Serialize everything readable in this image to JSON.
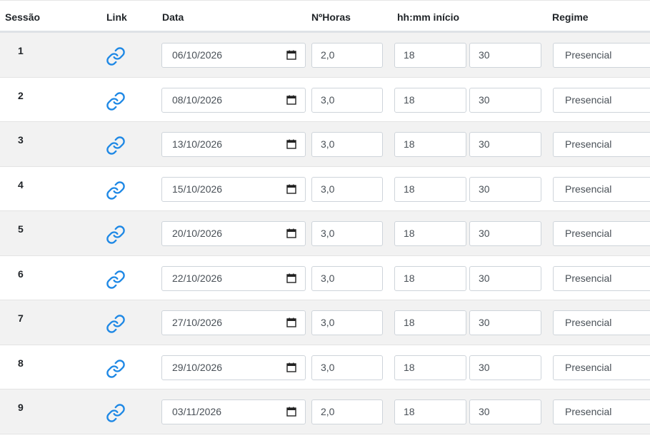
{
  "headers": {
    "sessao": "Sessão",
    "link": "Link",
    "data": "Data",
    "horas": "NºHoras",
    "inicio": "hh:mm início",
    "regime": "Regime"
  },
  "icons": {
    "link": "link-chain-icon",
    "calendar": "calendar-icon",
    "accent": "#1e88e5"
  },
  "rows": [
    {
      "num": "1",
      "date": "06/10/2026",
      "hours": "2,0",
      "hh": "18",
      "mm": "30",
      "regime": "Presencial"
    },
    {
      "num": "2",
      "date": "08/10/2026",
      "hours": "3,0",
      "hh": "18",
      "mm": "30",
      "regime": "Presencial"
    },
    {
      "num": "3",
      "date": "13/10/2026",
      "hours": "3,0",
      "hh": "18",
      "mm": "30",
      "regime": "Presencial"
    },
    {
      "num": "4",
      "date": "15/10/2026",
      "hours": "3,0",
      "hh": "18",
      "mm": "30",
      "regime": "Presencial"
    },
    {
      "num": "5",
      "date": "20/10/2026",
      "hours": "3,0",
      "hh": "18",
      "mm": "30",
      "regime": "Presencial"
    },
    {
      "num": "6",
      "date": "22/10/2026",
      "hours": "3,0",
      "hh": "18",
      "mm": "30",
      "regime": "Presencial"
    },
    {
      "num": "7",
      "date": "27/10/2026",
      "hours": "3,0",
      "hh": "18",
      "mm": "30",
      "regime": "Presencial"
    },
    {
      "num": "8",
      "date": "29/10/2026",
      "hours": "3,0",
      "hh": "18",
      "mm": "30",
      "regime": "Presencial"
    },
    {
      "num": "9",
      "date": "03/11/2026",
      "hours": "2,0",
      "hh": "18",
      "mm": "30",
      "regime": "Presencial"
    }
  ]
}
